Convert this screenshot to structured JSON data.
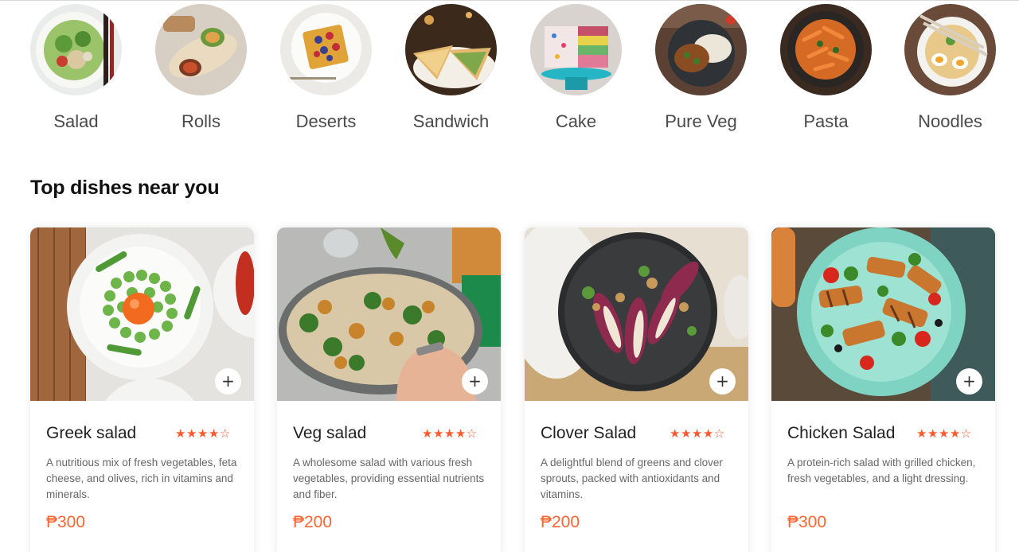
{
  "categories": [
    {
      "label": "Salad",
      "icon": "salad-bowl-icon"
    },
    {
      "label": "Rolls",
      "icon": "wrap-roll-icon"
    },
    {
      "label": "Deserts",
      "icon": "waffle-dessert-icon"
    },
    {
      "label": "Sandwich",
      "icon": "sandwich-icon"
    },
    {
      "label": "Cake",
      "icon": "cake-icon"
    },
    {
      "label": "Pure Veg",
      "icon": "veg-curry-icon"
    },
    {
      "label": "Pasta",
      "icon": "pasta-icon"
    },
    {
      "label": "Noodles",
      "icon": "noodle-bowl-icon"
    }
  ],
  "section_title": "Top dishes near you",
  "dishes": [
    {
      "name": "Greek salad",
      "stars": "★★★★☆",
      "rating": 4,
      "description": "A nutritious mix of fresh vegetables, feta cheese, and olives, rich in vitamins and minerals.",
      "price": "₱300",
      "add_label": "+"
    },
    {
      "name": "Veg salad",
      "stars": "★★★★☆",
      "rating": 4,
      "description": "A wholesome salad with various fresh vegetables, providing essential nutrients and fiber.",
      "price": "₱200",
      "add_label": "+"
    },
    {
      "name": "Clover Salad",
      "stars": "★★★★☆",
      "rating": 4,
      "description": "A delightful blend of greens and clover sprouts, packed with antioxidants and vitamins.",
      "price": "₱200",
      "add_label": "+"
    },
    {
      "name": "Chicken Salad",
      "stars": "★★★★☆",
      "rating": 4,
      "description": "A protein-rich salad with grilled chicken, fresh vegetables, and a light dressing.",
      "price": "₱300",
      "add_label": "+"
    }
  ],
  "colors": {
    "accent": "#ff6533",
    "star": "#ff5a2e",
    "text_dark": "#222222",
    "text_muted": "#676767"
  }
}
